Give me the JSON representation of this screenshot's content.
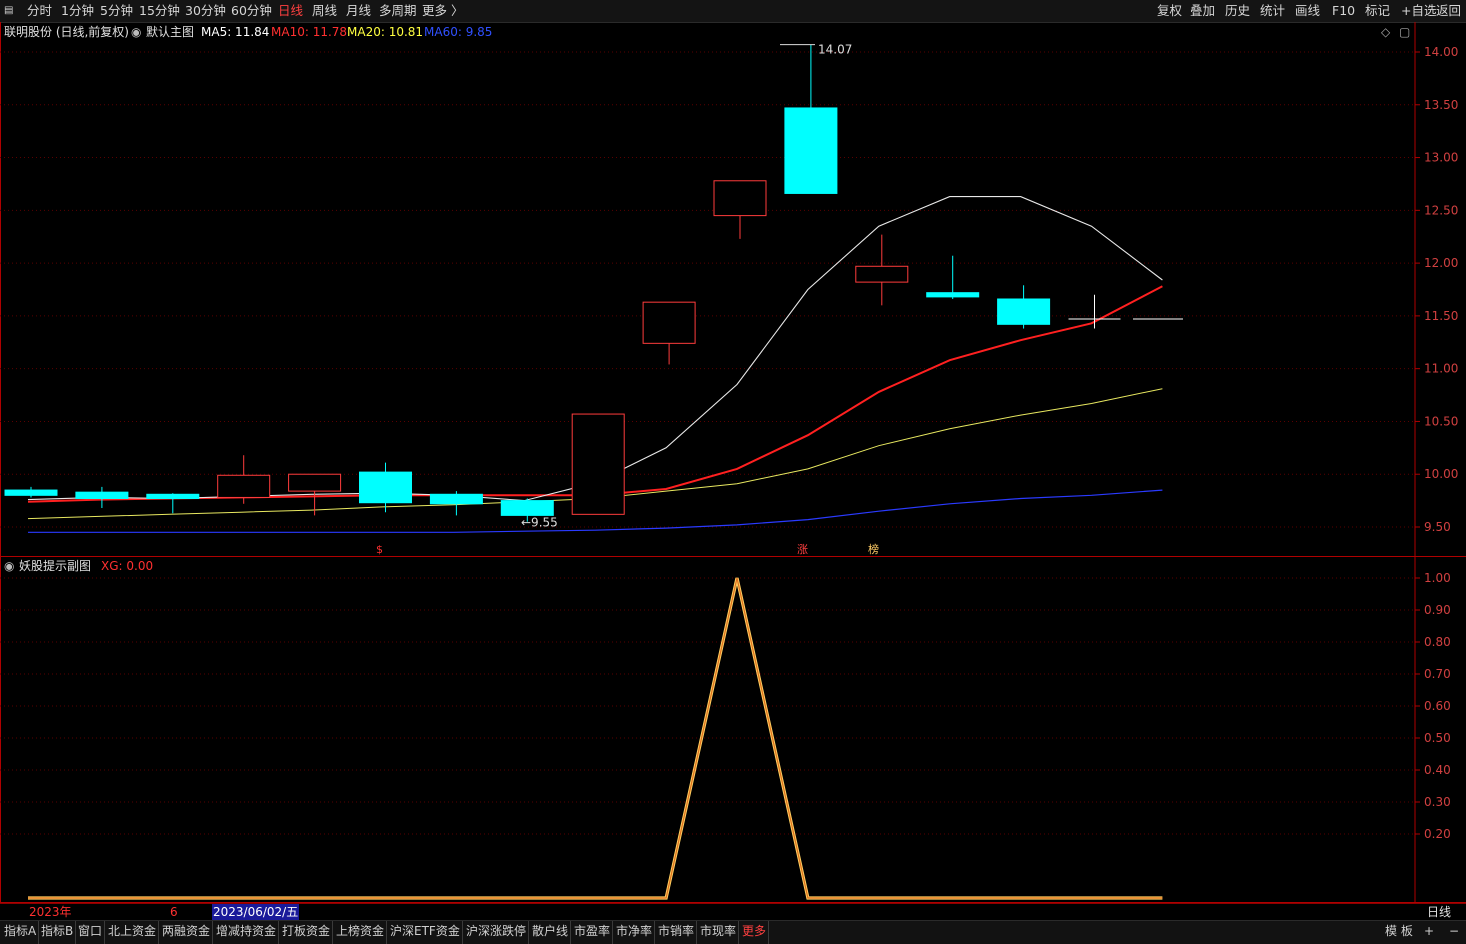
{
  "toolbar": {
    "menu_icon": "menu-icon",
    "periods": [
      "分时",
      "1分钟",
      "5分钟",
      "15分钟",
      "30分钟",
      "60分钟",
      "日线",
      "周线",
      "月线",
      "多周期",
      "更多 〉"
    ],
    "active_period": "日线",
    "right_buttons": [
      "复权",
      "叠加",
      "历史",
      "统计",
      "画线",
      "F10",
      "标记",
      "+自选",
      "返回"
    ]
  },
  "main_chart": {
    "stock_label": "联明股份 (日线,前复权)",
    "template_name": "默认主图",
    "ma": [
      {
        "label": "MA5: 11.84",
        "color": "#ffffff"
      },
      {
        "label": "MA10: 11.78",
        "color": "#ff3030"
      },
      {
        "label": "MA20: 10.81",
        "color": "#ffff40"
      },
      {
        "label": "MA60: 9.85",
        "color": "#3050ff"
      }
    ],
    "y_ticks": [
      "14.00",
      "13.50",
      "13.00",
      "12.50",
      "12.00",
      "11.50",
      "11.00",
      "10.50",
      "10.00",
      "9.50"
    ],
    "high_annotation": "14.07",
    "low_annotation": "9.55",
    "markers": [
      "$",
      "涨",
      "榜"
    ]
  },
  "sub_chart": {
    "name": "妖股提示副图",
    "value_label": "XG: 0.00",
    "y_ticks": [
      "1.00",
      "0.90",
      "0.80",
      "0.70",
      "0.60",
      "0.50",
      "0.40",
      "0.30",
      "0.20"
    ]
  },
  "date_axis": {
    "year_label": "2023年",
    "month_label": "6",
    "cursor_date": "2023/06/02/五",
    "period_label": "日线"
  },
  "bottombar": {
    "tabs": [
      "指标A",
      "指标B",
      "窗口",
      "北上资金",
      "两融资金",
      "增减持资金",
      "打板资金",
      "上榜资金",
      "沪深ETF资金",
      "沪深涨跌停",
      "散户线",
      "市盈率",
      "市净率",
      "市销率",
      "市现率",
      "更多"
    ],
    "right_buttons": [
      "模 板",
      "+",
      "−"
    ]
  },
  "chart_data": {
    "type": "candlestick",
    "y_range": [
      9.3,
      14.1
    ],
    "candles": [
      {
        "open": 9.85,
        "close": 9.8,
        "high": 9.88,
        "low": 9.78
      },
      {
        "open": 9.83,
        "close": 9.77,
        "high": 9.88,
        "low": 9.68
      },
      {
        "open": 9.81,
        "close": 9.77,
        "high": 9.82,
        "low": 9.63
      },
      {
        "open": 9.78,
        "close": 9.99,
        "high": 10.18,
        "low": 9.72
      },
      {
        "open": 9.84,
        "close": 10.0,
        "high": 10.0,
        "low": 9.61
      },
      {
        "open": 10.02,
        "close": 9.73,
        "high": 10.11,
        "low": 9.64
      },
      {
        "open": 9.81,
        "close": 9.72,
        "high": 9.84,
        "low": 9.61
      },
      {
        "open": 9.75,
        "close": 9.61,
        "high": 9.77,
        "low": 9.55
      },
      {
        "open": 9.62,
        "close": 10.57,
        "high": 10.57,
        "low": 9.62
      },
      {
        "open": 11.24,
        "close": 11.63,
        "high": 11.63,
        "low": 11.04
      },
      {
        "open": 12.45,
        "close": 12.78,
        "high": 12.78,
        "low": 12.23
      },
      {
        "open": 13.47,
        "close": 12.66,
        "high": 14.07,
        "low": 12.66
      },
      {
        "open": 11.82,
        "close": 11.97,
        "high": 12.27,
        "low": 11.6
      },
      {
        "open": 11.72,
        "close": 11.68,
        "high": 12.07,
        "low": 11.66
      },
      {
        "open": 11.66,
        "close": 11.42,
        "high": 11.79,
        "low": 11.38
      },
      {
        "open": 11.47,
        "close": 11.47,
        "high": 11.7,
        "low": 11.38
      }
    ],
    "ma5": [
      9.76,
      9.78,
      9.77,
      9.79,
      9.81,
      9.82,
      9.8,
      9.75,
      9.92,
      10.25,
      10.85,
      11.75,
      12.35,
      12.63,
      12.63,
      12.35,
      11.84
    ],
    "ma10": [
      9.74,
      9.76,
      9.77,
      9.78,
      9.79,
      9.8,
      9.8,
      9.8,
      9.8,
      9.86,
      10.05,
      10.37,
      10.78,
      11.08,
      11.27,
      11.43,
      11.78
    ],
    "ma20": [
      9.58,
      9.6,
      9.62,
      9.64,
      9.66,
      9.69,
      9.71,
      9.74,
      9.77,
      9.84,
      9.91,
      10.05,
      10.27,
      10.43,
      10.56,
      10.67,
      10.81
    ],
    "ma60": [
      9.45,
      9.45,
      9.45,
      9.45,
      9.45,
      9.45,
      9.45,
      9.46,
      9.47,
      9.49,
      9.52,
      9.57,
      9.65,
      9.72,
      9.77,
      9.8,
      9.85
    ],
    "xg": [
      0,
      0,
      0,
      0,
      0,
      0,
      0,
      0,
      0,
      0,
      1,
      0,
      0,
      0,
      0,
      0,
      0
    ],
    "xg_range": [
      0,
      1.0
    ]
  }
}
